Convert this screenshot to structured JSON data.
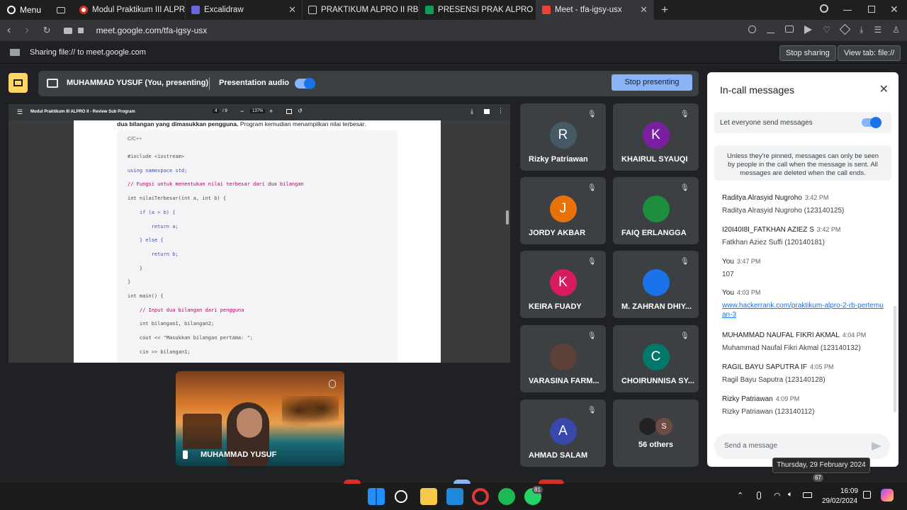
{
  "browser": {
    "menu_label": "Menu",
    "tabs": [
      {
        "label": "Modul Praktikum III ALPRO",
        "icon": "chrome-icon"
      },
      {
        "label": "Excalidraw",
        "icon": "excalidraw-icon"
      },
      {
        "label": "PRAKTIKUM ALPRO II RB K",
        "icon": "file-icon"
      },
      {
        "label": "PRESENSI PRAK ALPRO 2 R",
        "icon": "sheets-icon"
      },
      {
        "label": "Meet - tfa-igsy-usx",
        "icon": "meet-icon",
        "active": true
      }
    ],
    "url": "meet.google.com/tfa-igsy-usx"
  },
  "share_bar": {
    "text": "Sharing file:// to meet.google.com",
    "stop_label": "Stop sharing",
    "view_label": "View tab: file://"
  },
  "present_bar": {
    "presenter": "MUHAMMAD YUSUF (You, presenting)",
    "audio_label": "Presentation audio",
    "stop_label": "Stop presenting"
  },
  "pdf": {
    "title": "Modul Praktikum III ALPRO II - Review Sub Program",
    "page": "4",
    "pages": "/ 9",
    "zoom": "137%",
    "intro": "dua bilangan yang dimasukkan pengguna.",
    "intro_rest": " Program kemudian menampilkan nilai terbesar.",
    "lang": "C/C++",
    "code": [
      {
        "t": "#include <iostream>",
        "c": "dir"
      },
      {
        "t": "using namespace std;",
        "c": "kw"
      },
      {
        "t": "// Fungsi untuk menentukan nilai terbesar dari dua bilangan",
        "c": "cm"
      },
      {
        "t": "int nilaiTerbesar(int a, int b) {",
        "c": "fn"
      },
      {
        "t": "    if (a > b) {",
        "c": "kw"
      },
      {
        "t": "        return a;",
        "c": "kw"
      },
      {
        "t": "    } else {",
        "c": "kw"
      },
      {
        "t": "        return b;",
        "c": "kw"
      },
      {
        "t": "    }",
        "c": "plain"
      },
      {
        "t": "}",
        "c": "plain"
      },
      {
        "t": "int main() {",
        "c": "fn"
      },
      {
        "t": "    // Input dua bilangan dari pengguna",
        "c": "cm"
      },
      {
        "t": "    int bilangan1, bilangan2;",
        "c": "fn"
      },
      {
        "t": "    cout << \"Masukkan bilangan pertama: \";",
        "c": "str"
      },
      {
        "t": "    cin >> bilangan1;",
        "c": "plain"
      }
    ]
  },
  "self_tile": {
    "name": "MUHAMMAD YUSUF"
  },
  "participants": [
    {
      "name": "Rizky Patriawan",
      "initial": "R",
      "color": "#455a64"
    },
    {
      "name": "KHAIRUL SYAUQI",
      "initial": "K",
      "color": "#7b1fa2"
    },
    {
      "name": "JORDY AKBAR",
      "initial": "J",
      "color": "#e8710a"
    },
    {
      "name": "FAIQ ERLANGGA",
      "initial": "",
      "color": "#1e8e3e"
    },
    {
      "name": "KEIRA FUADY",
      "initial": "K",
      "color": "#d81b60"
    },
    {
      "name": "M. ZAHRAN DHIY...",
      "initial": "",
      "color": "#1a73e8"
    },
    {
      "name": "VARASINA FARM...",
      "initial": "",
      "color": "#5d4037"
    },
    {
      "name": "CHOIRUNNISA SY...",
      "initial": "C",
      "color": "#00796b"
    },
    {
      "name": "AHMAD SALAM",
      "initial": "A",
      "color": "#3949ab"
    },
    {
      "name": "56 others",
      "initial": "S",
      "color": "#6d4c41"
    }
  ],
  "chat": {
    "title": "In-call messages",
    "toggle_label": "Let everyone send messages",
    "notice": "Unless they're pinned, messages can only be seen by people in the call when the message is sent. All messages are deleted when the call ends.",
    "messages": [
      {
        "sender": "Raditya Alrasyid Nugroho",
        "time": "3:42 PM",
        "text": "Raditya Alrasyid Nugroho  (123140125)"
      },
      {
        "sender": "I20I40I8I_FATKHAN AZIEZ S",
        "time": "3:42 PM",
        "text": "Fatkhan Aziez Suffi (120140181)"
      },
      {
        "sender": "You",
        "time": "3:47 PM",
        "text": "107"
      },
      {
        "sender": "You",
        "time": "4:03 PM",
        "text": "www.hackerrank.com/praktikum-alpro-2-rb-pertemuan-3",
        "link": true
      },
      {
        "sender": "MUHAMMAD NAUFAL FIKRI AKMAL",
        "time": "4:04 PM",
        "text": "Muhammad Naufal Fikri Akmal (123140132)"
      },
      {
        "sender": "RAGIL BAYU SAPUTRA IF",
        "time": "4:05 PM",
        "text": "Ragil Bayu Saputra (123140128)"
      },
      {
        "sender": "Rizky Patriawan",
        "time": "4:09 PM",
        "text": "Rizky Patriawan (123140112)"
      }
    ],
    "input_placeholder": "Send a message"
  },
  "tooltip": "Thursday, 29 February 2024",
  "taskbar": {
    "time": "16:09",
    "date": "29/02/2024",
    "badge": "81",
    "badge2": "67"
  }
}
